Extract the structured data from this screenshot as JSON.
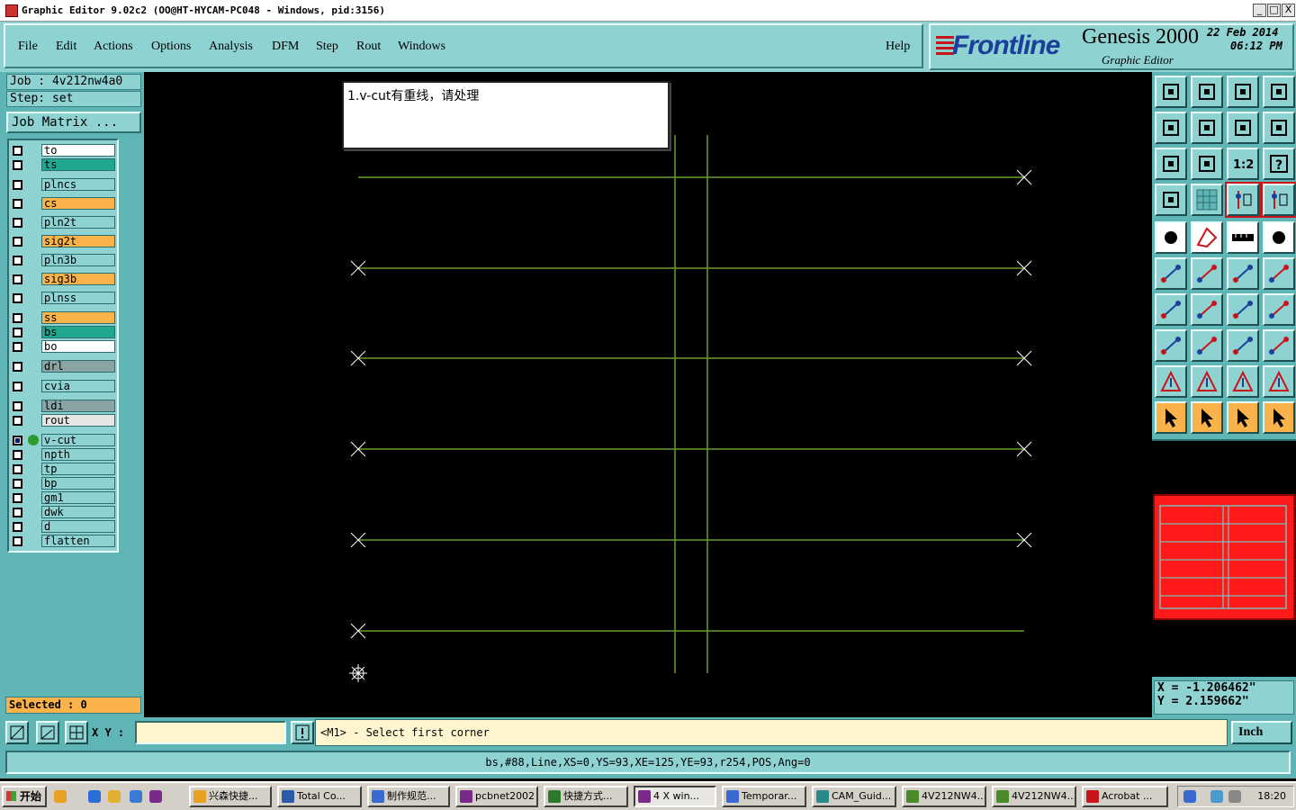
{
  "window": {
    "title": "Graphic Editor 9.02c2  (OO@HT-HYCAM-PC048 - Windows, pid:3156)",
    "min": "_",
    "max": "□",
    "close": "X"
  },
  "menu": [
    "File",
    "Edit",
    "Actions",
    "Options",
    "Analysis",
    "DFM",
    "Step",
    "Rout",
    "Windows"
  ],
  "help": "Help",
  "brand": {
    "logo": "Frontline",
    "product": "Genesis 2000",
    "subtitle": "Graphic Editor",
    "date": "22 Feb 2014",
    "time": "06:12 PM"
  },
  "job": {
    "job_line": "Job  :  4v212nw4a0",
    "step_line": "Step:  set",
    "matrix_button": "Job Matrix ..."
  },
  "layers": [
    {
      "name": "to",
      "color": "#ffffff"
    },
    {
      "name": "ts",
      "color": "#1fa88f"
    },
    {
      "name": "plncs",
      "color": "#8ed2d2"
    },
    {
      "name": "cs",
      "color": "#f9b34a"
    },
    {
      "name": "pln2t",
      "color": "#8ed2d2"
    },
    {
      "name": "sig2t",
      "color": "#f9b34a"
    },
    {
      "name": "pln3b",
      "color": "#8ed2d2"
    },
    {
      "name": "sig3b",
      "color": "#f9b34a"
    },
    {
      "name": "plnss",
      "color": "#8ed2d2"
    },
    {
      "name": "ss",
      "color": "#f9b34a"
    },
    {
      "name": "bs",
      "color": "#1fa88f"
    },
    {
      "name": "bo",
      "color": "#ffffff"
    },
    {
      "name": "drl",
      "color": "#8aa3a3"
    },
    {
      "name": "cvia",
      "color": "#8ed2d2"
    },
    {
      "name": "ldi",
      "color": "#8aa3a3"
    },
    {
      "name": "rout",
      "color": "#e6e6e6"
    },
    {
      "name": "v-cut",
      "color": "#8ed2d2",
      "active": true
    },
    {
      "name": "npth",
      "color": "#8ed2d2"
    },
    {
      "name": "tp",
      "color": "#8ed2d2"
    },
    {
      "name": "bp",
      "color": "#8ed2d2"
    },
    {
      "name": "gm1",
      "color": "#8ed2d2"
    },
    {
      "name": "dwk",
      "color": "#8ed2d2"
    },
    {
      "name": "d",
      "color": "#8ed2d2"
    },
    {
      "name": "flatten",
      "color": "#8ed2d2"
    }
  ],
  "selected": "Selected : 0",
  "message": "1.v-cut有重线，请处理",
  "coords": {
    "x": "X = -1.206462\"",
    "y": "Y = 2.159662\""
  },
  "cmd": {
    "xy_label": "X Y :",
    "xy_value": "",
    "prompt": "<M1> - Select first corner",
    "units": "Inch"
  },
  "status": "bs,#88,Line,XS=0,YS=93,XE=125,YE=93,r254,POS,Ang=0",
  "taskbar": {
    "start": "开始",
    "items": [
      "兴森快捷...",
      "Total Co...",
      "制作规范...",
      "pcbnet2002",
      "快捷方式...",
      "4 X win...",
      "Temporar...",
      "CAM_Guid...",
      "4V212NW4...",
      "4V212NW4...",
      "Acrobat ..."
    ],
    "clock": "18:20"
  },
  "colors": {
    "panel": "#5fb5b5",
    "panel_light": "#8ed2d2",
    "vcut_line": "#6b9a2c",
    "minimap_fill": "#ff1a1a",
    "minimap_outline": "#5fe0e0"
  }
}
